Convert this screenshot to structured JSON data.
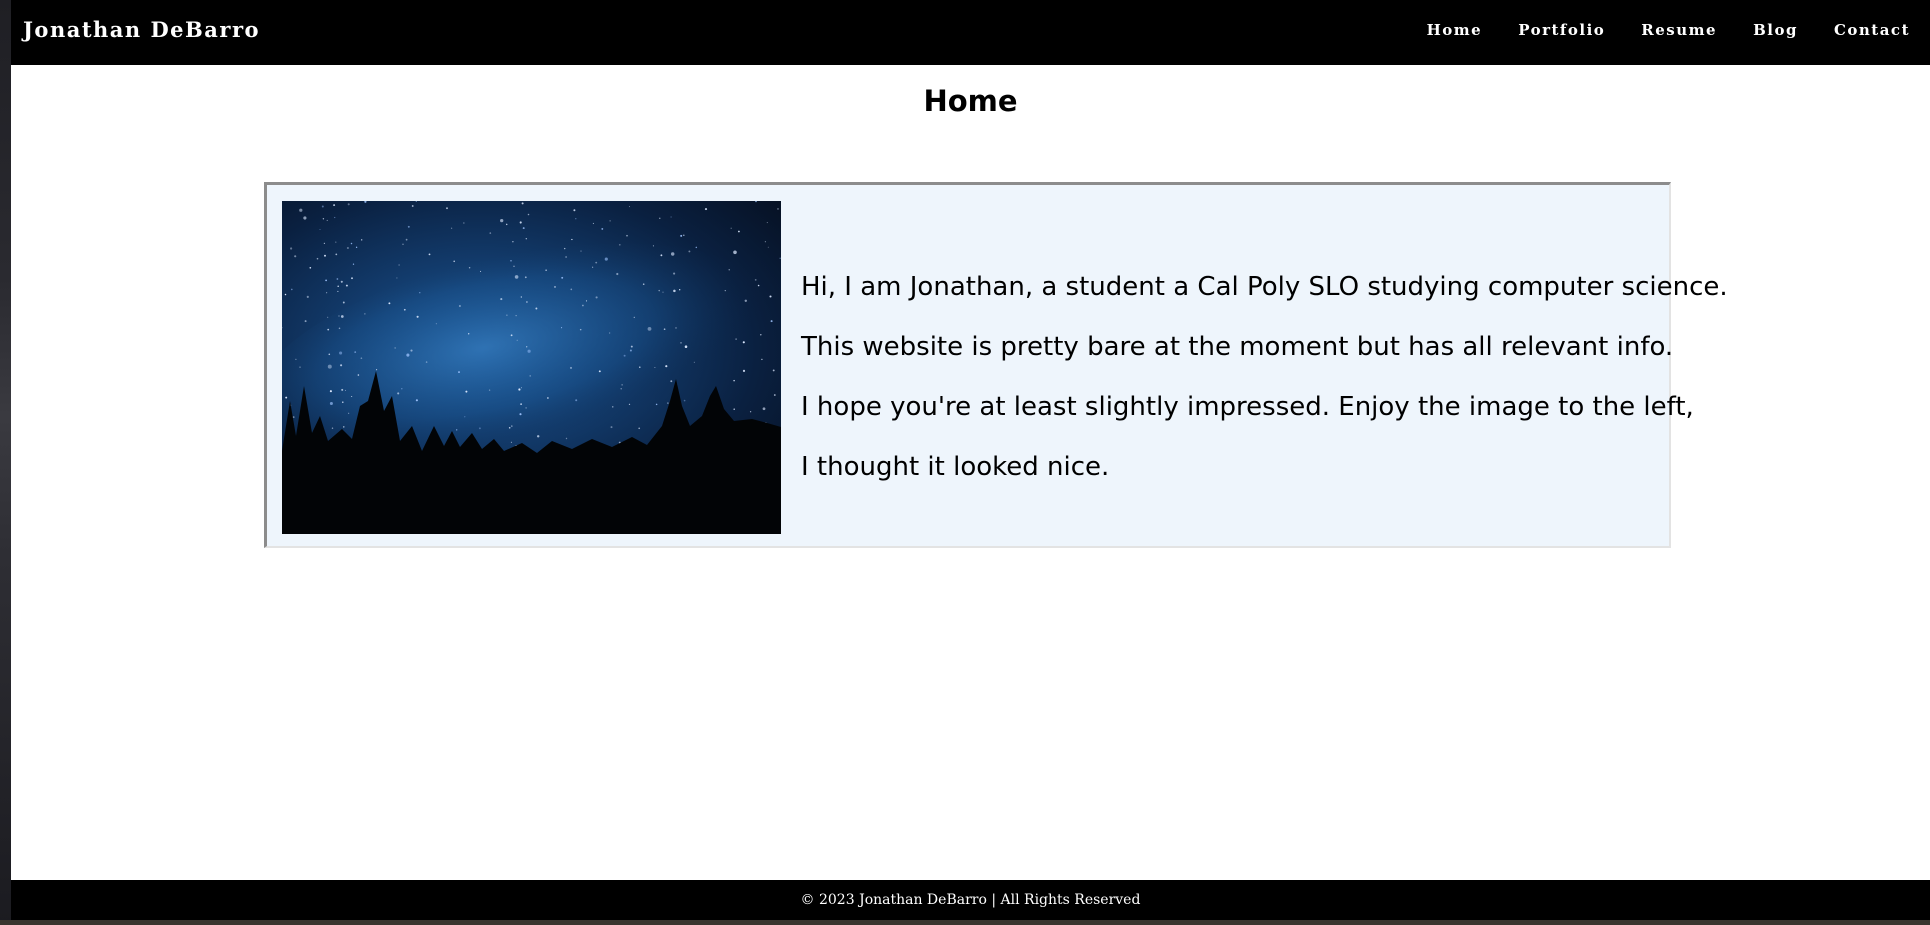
{
  "navbar": {
    "brand": "Jonathan DeBarro",
    "links": [
      "Home",
      "Portfolio",
      "Resume",
      "Blog",
      "Contact"
    ]
  },
  "main": {
    "title": "Home",
    "intro_lines": [
      "Hi, I am Jonathan, a student a Cal Poly SLO studying computer science.",
      "This website is pretty bare at the moment but has all relevant info.",
      "I hope you're at least slightly impressed. Enjoy the image to the left,",
      "I thought it looked nice."
    ]
  },
  "footer": {
    "text": "© 2023 Jonathan DeBarro | All Rights Reserved"
  },
  "colors": {
    "navbar_bg": "#000000",
    "card_bg": "#eef5fc",
    "footer_bg": "#000000"
  }
}
